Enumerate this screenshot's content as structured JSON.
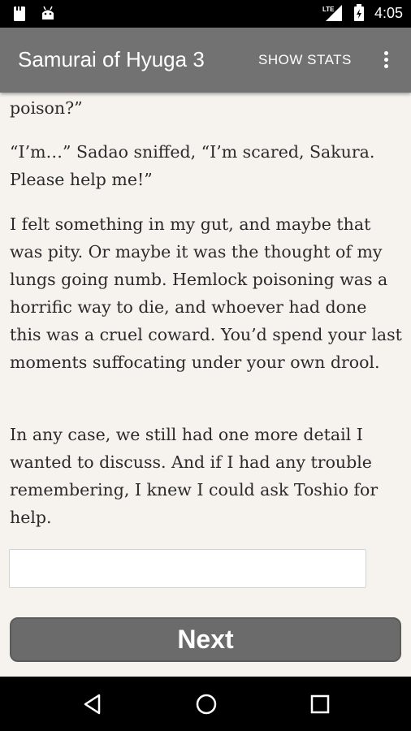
{
  "status_bar": {
    "time": "4:05",
    "network": "LTE",
    "icons": [
      "image-notification-icon",
      "android-notification-icon",
      "lte-signal-icon",
      "battery-icon"
    ]
  },
  "app_bar": {
    "title": "Samurai of Hyuga 3",
    "show_stats_label": "SHOW STATS",
    "overflow_icon": "more-vert-icon"
  },
  "story": {
    "paragraphs": [
      "poison?”",
      "“I’m…” Sadao sniffed, “I’m scared, Sakura. Please help me!”",
      "I felt something in my gut, and maybe that was pity. Or maybe it was the thought of my lungs going numb. Hemlock poisoning was a horrific way to die, and whoever had done this was a cruel coward. You’d spend your last moments suffocating under your own drool.",
      "In any case, we still had one more detail I wanted to discuss. And if I had any trouble remembering, I knew I could ask Toshio for help."
    ]
  },
  "input": {
    "value": "",
    "placeholder": ""
  },
  "next_button_label": "Next",
  "nav_bar": {
    "icons": [
      "back-icon",
      "home-icon",
      "recents-icon"
    ]
  }
}
